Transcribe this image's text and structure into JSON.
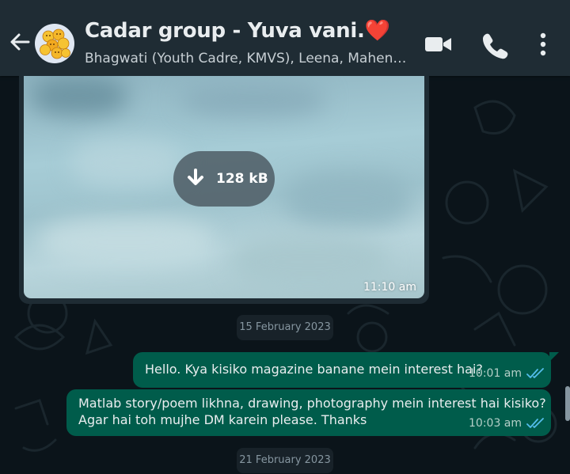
{
  "header": {
    "title": "Cadar group - Yuva vani.",
    "title_emoji": "❤️",
    "subtitle": "Bhagwati (Youth Cadre, KMVS), Leena, Mahen…",
    "icons": [
      "back-arrow-icon",
      "group-avatar",
      "video-call-icon",
      "voice-call-icon",
      "more-options-icon"
    ]
  },
  "image_message": {
    "download_size": "128 kB",
    "time": "11:10 am"
  },
  "dates": {
    "first": "15 February 2023",
    "second": "21 February 2023"
  },
  "messages": [
    {
      "text": "Hello. Kya kisiko magazine banane mein interest hai?",
      "time": "10:01 am",
      "status": "read"
    },
    {
      "line1": "Matlab story/poem likhna, drawing, photography mein interest hai kisiko?",
      "line2": "Agar hai toh mujhe DM karein please. Thanks",
      "time": "10:03 am",
      "status": "read"
    }
  ],
  "colors": {
    "header_bg": "#1f2c34",
    "chat_bg": "#0b141a",
    "outgoing_bubble": "#005c4b",
    "read_tick": "#53bdeb"
  }
}
